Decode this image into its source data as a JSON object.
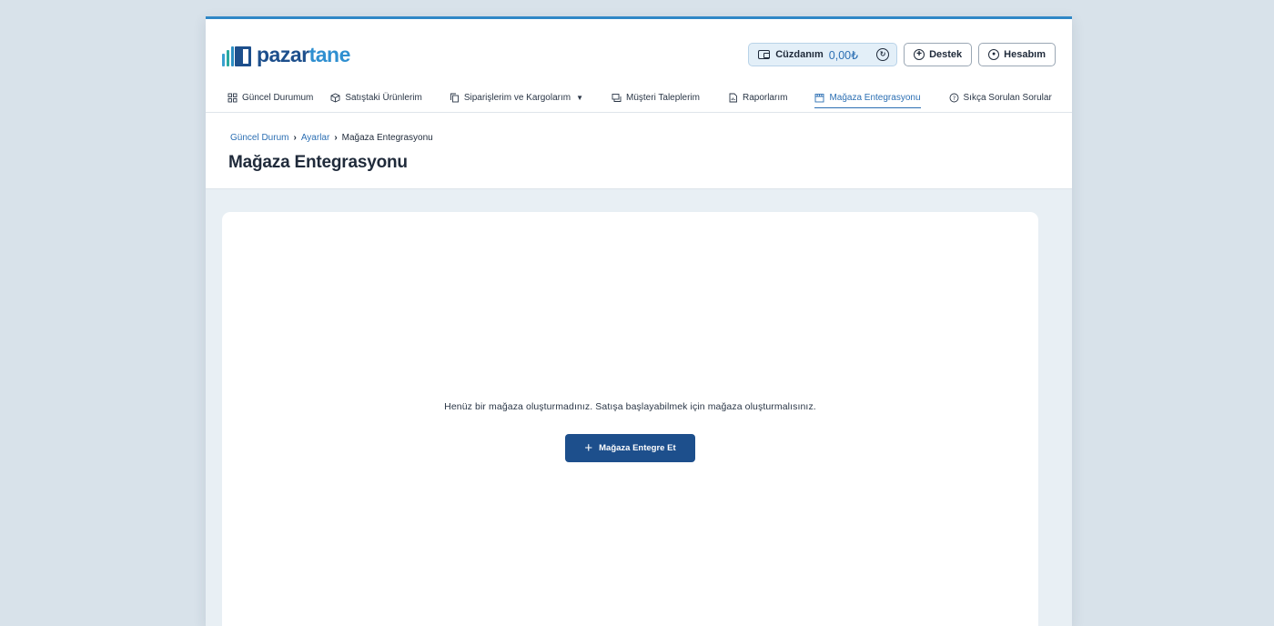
{
  "brand": {
    "name_part1": "pazar",
    "name_part2": "tane"
  },
  "wallet": {
    "label": "Cüzdanım",
    "amount": "0,00₺"
  },
  "header_actions": {
    "support_label": "Destek",
    "account_label": "Hesabım"
  },
  "nav": [
    {
      "label": "Güncel Durumum",
      "icon": "grid-icon"
    },
    {
      "label": "Satıştaki Ürünlerim",
      "icon": "box-icon"
    },
    {
      "label": "Siparişlerim ve Kargolarım",
      "icon": "copy-icon",
      "has_caret": true
    },
    {
      "label": "Müşteri Taleplerim",
      "icon": "chat-icon"
    },
    {
      "label": "Raporlarım",
      "icon": "report-icon"
    },
    {
      "label": "Mağaza Entegrasyonu",
      "icon": "store-icon",
      "active": true
    },
    {
      "label": "Sıkça Sorulan Sorular",
      "icon": "help-icon"
    }
  ],
  "breadcrumb": {
    "item1": "Güncel Durum",
    "item2": "Ayarlar",
    "current": "Mağaza Entegrasyonu"
  },
  "page": {
    "title": "Mağaza Entegrasyonu"
  },
  "empty_state": {
    "message": "Henüz bir mağaza oluşturmadınız. Satışa başlayabilmek için mağaza oluşturmalısınız.",
    "button_label": "Mağaza Entegre Et"
  },
  "colors": {
    "primary": "#1d4f8c",
    "accent_blue": "#2c6fb3",
    "top_border": "#2f87c6",
    "page_background": "#d8e2ea"
  }
}
